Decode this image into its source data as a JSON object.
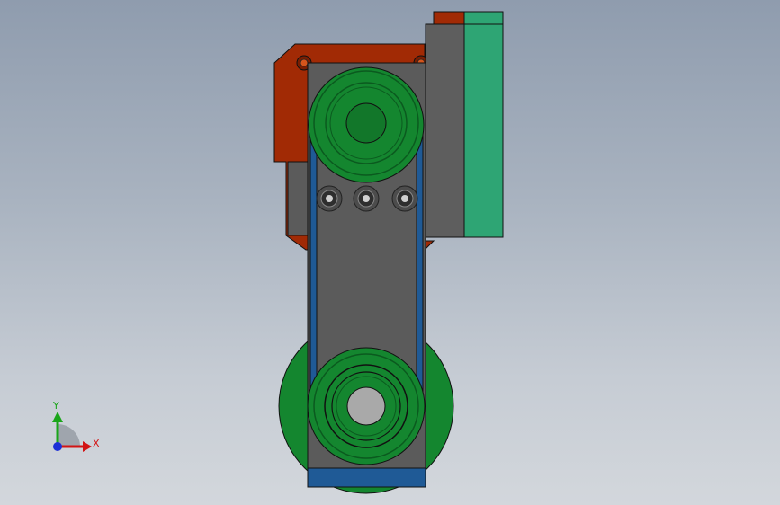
{
  "viewport": {
    "background_top": "#8f9cae",
    "background_bottom": "#d3d7dc"
  },
  "colors": {
    "housing_red": "#a12a05",
    "body_gray": "#5b5b5b",
    "pulley_green": "#14862f",
    "pulley_green_dark": "#0b5a1f",
    "rail_green": "#2ea574",
    "belt_blue": "#1f5a96",
    "hub_gray": "#a9a9a9",
    "outline": "#111111"
  },
  "triad": {
    "x_label": "X",
    "y_label": "Y",
    "x_color": "#d21414",
    "y_color": "#1aa51a",
    "z_color": "#1c2fd6"
  }
}
